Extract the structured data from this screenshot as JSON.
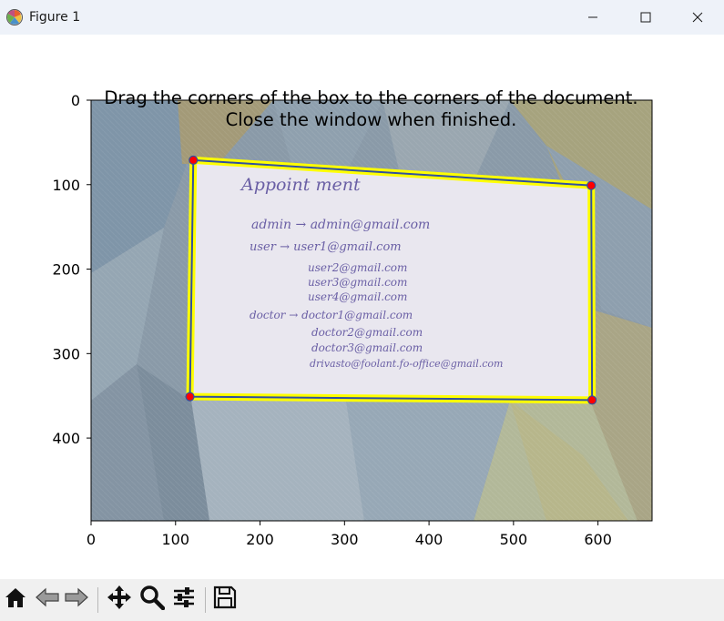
{
  "window": {
    "title": "Figure 1",
    "icons": [
      "matplotlib-logo-icon",
      "minimize-icon",
      "maximize-icon",
      "close-icon"
    ]
  },
  "figure": {
    "title_line1": "Drag the corners of the box to the corners of the document.",
    "title_line2": "Close the window when finished."
  },
  "chart_data": {
    "type": "image",
    "title": "Drag the corners of the box to the corners of the document.\nClose the window when finished.",
    "xlim": [
      0,
      664
    ],
    "ylim": [
      498,
      0
    ],
    "xticks": [
      0,
      100,
      200,
      300,
      400,
      500,
      600
    ],
    "yticks": [
      0,
      100,
      200,
      300,
      400
    ],
    "xtick_labels": [
      "0",
      "100",
      "200",
      "300",
      "400",
      "500",
      "600"
    ],
    "ytick_labels": [
      "0",
      "100",
      "200",
      "300",
      "400"
    ],
    "grid": false,
    "box_corners": [
      [
        121,
        71
      ],
      [
        592,
        101
      ],
      [
        593,
        355
      ],
      [
        117,
        351
      ]
    ],
    "box_outline_color": "#ffff00",
    "box_inner_color": "#3050a0",
    "corner_marker_color": "#ff0000",
    "document_text": [
      "Appoint ment",
      "admin → admin@gmail.com",
      "user → user1@gmail.com",
      "user2@gmail.com",
      "user3@gmail.com",
      "user4@gmail.com",
      "doctor → doctor1@gmail.com",
      "doctor2@gmail.com",
      "doctor3@gmail.com",
      "drivasto@foolant.fo-office@gmail.com"
    ]
  },
  "toolbar": {
    "buttons": [
      {
        "name": "home-icon",
        "label": "Home"
      },
      {
        "name": "back-icon",
        "label": "Back"
      },
      {
        "name": "forward-icon",
        "label": "Forward"
      },
      {
        "name": "pan-icon",
        "label": "Pan"
      },
      {
        "name": "zoom-icon",
        "label": "Zoom"
      },
      {
        "name": "configure-subplots-icon",
        "label": "Subplots"
      },
      {
        "name": "save-icon",
        "label": "Save"
      }
    ]
  }
}
